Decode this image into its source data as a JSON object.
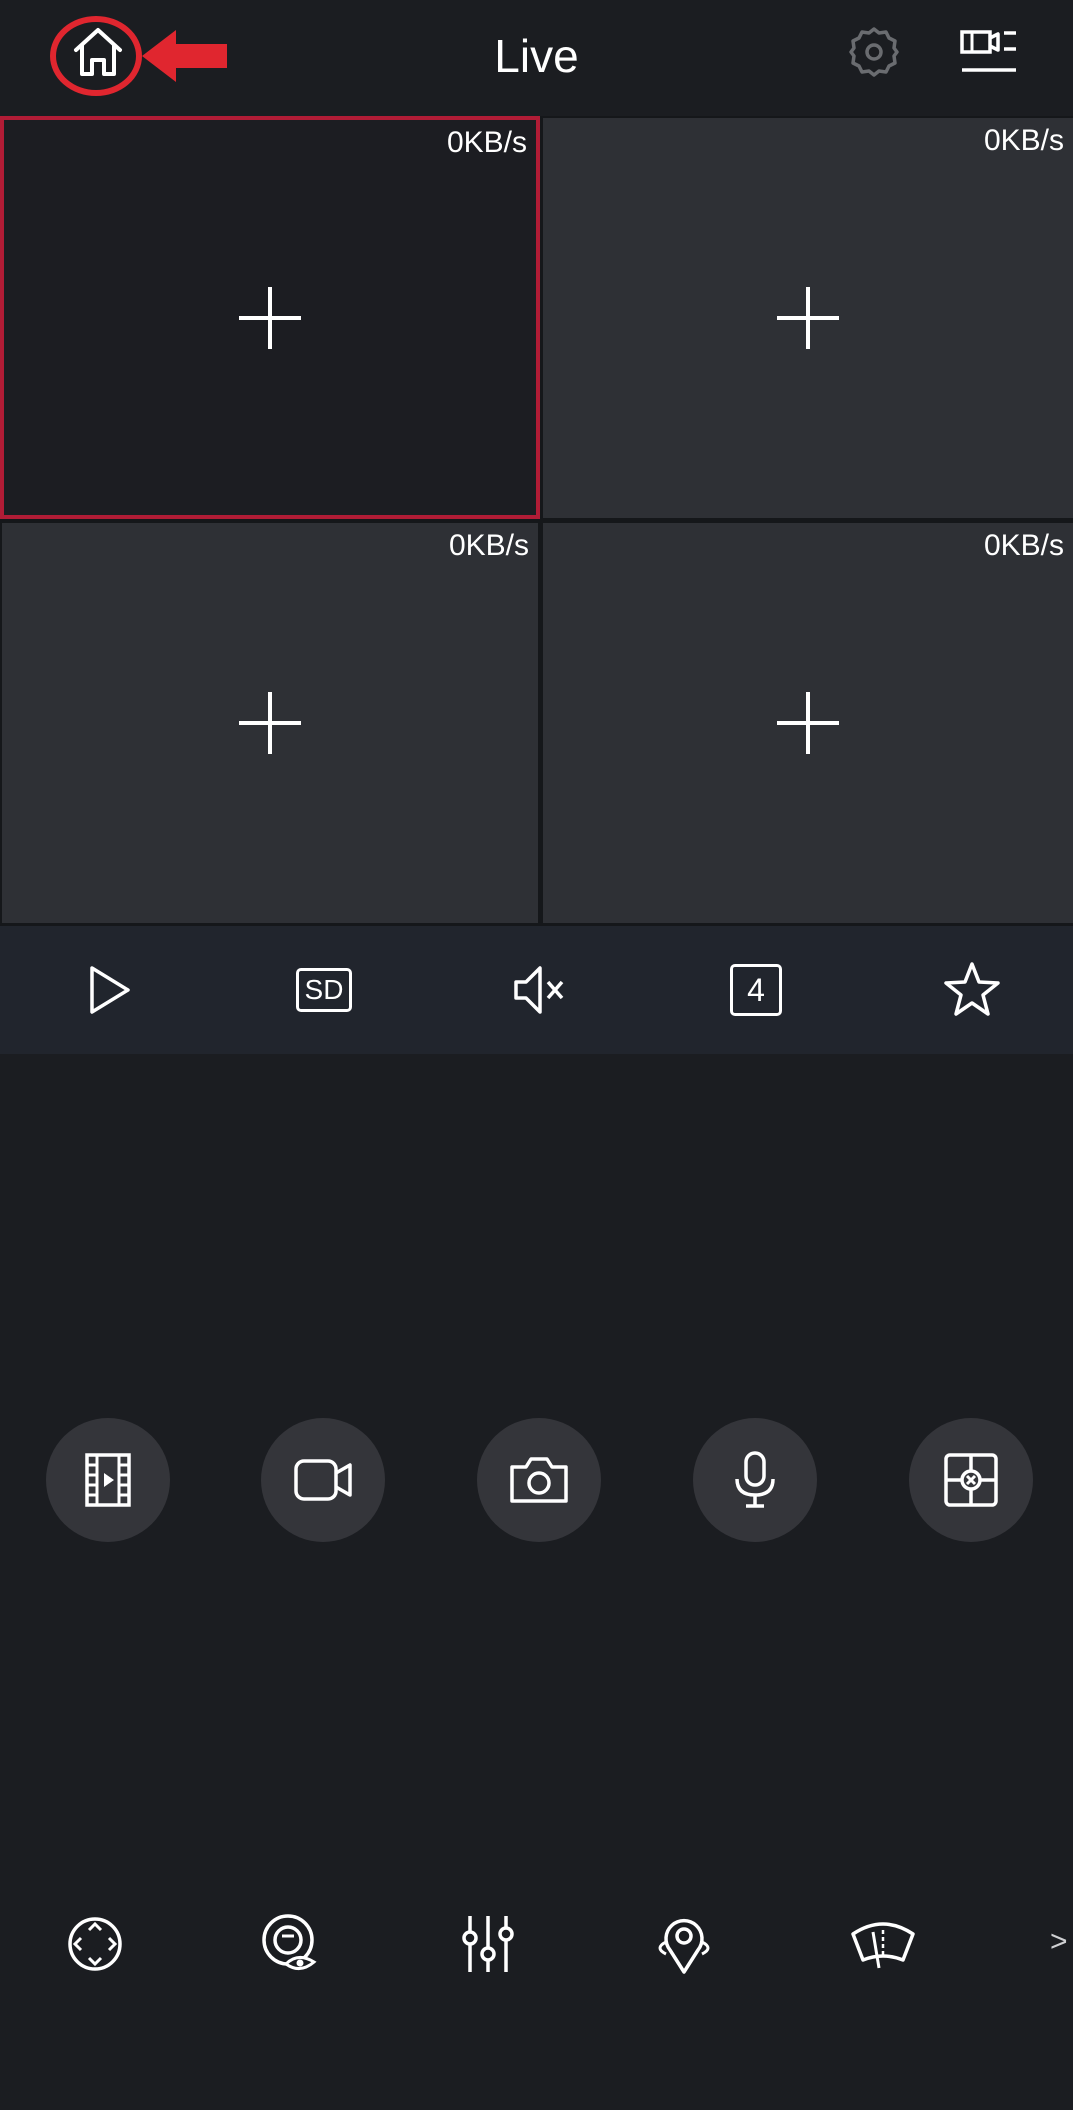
{
  "header": {
    "title": "Live",
    "home_icon": "home-icon",
    "settings_icon": "gear-icon",
    "device_list_icon": "device-list-icon"
  },
  "grid": {
    "cells": [
      {
        "rate": "0KB/s",
        "selected": true
      },
      {
        "rate": "0KB/s",
        "selected": false
      },
      {
        "rate": "0KB/s",
        "selected": false
      },
      {
        "rate": "0KB/s",
        "selected": false
      }
    ]
  },
  "toolbar": {
    "play_icon": "play-icon",
    "quality_label": "SD",
    "mute_icon": "speaker-muted-icon",
    "layout_label": "4",
    "favorite_icon": "star-icon"
  },
  "actions": {
    "items": [
      "record-icon",
      "video-camera-icon",
      "camera-icon",
      "microphone-icon",
      "target-icon"
    ]
  },
  "ptz": {
    "items": [
      "ptz-direction-icon",
      "eye-icon",
      "sliders-icon",
      "location-icon",
      "wiper-icon"
    ],
    "more_label": ">"
  },
  "colors": {
    "background": "#1b1d21",
    "cell_background": "#2e3035",
    "selected_border": "#b11c36",
    "toolbar_background": "#21252d",
    "button_background": "#34353a",
    "annotation_red": "#e0262f"
  }
}
